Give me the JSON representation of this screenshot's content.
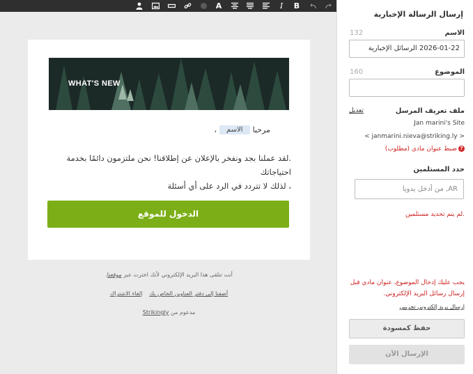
{
  "toolbar": {
    "icons": [
      "person-icon",
      "image-icon",
      "divider-icon",
      "link-icon",
      "color-dot-icon",
      "font-icon",
      "align-center-icon",
      "align-justify-icon",
      "align-left-icon",
      "italic-icon",
      "bold-icon",
      "undo-icon",
      "redo-icon"
    ],
    "font_glyph": "A",
    "italic_glyph": "I",
    "bold_glyph": "B"
  },
  "email": {
    "banner_text": "WHAT'S NEW",
    "greeting": "مرحبا",
    "name_placeholder": "الاسم",
    "greeting_comma": "،",
    "paragraph_line1": ".لقد عملنا بجد ونفخر بالإعلان عن إطلاقنا! نحن ملتزمون دائمًا بخدمة احتياجاتك",
    "paragraph_line2": "، لذلك لا تتردد في الرد على أي أسئلة",
    "button_label": "الدخول للموقع"
  },
  "footer": {
    "line1_text": "أنت تتلقى هذا البريد الإلكتروني لأنك اخترت عبر",
    "line1_link": "موقعنا",
    "line1_end": ".",
    "addbook_link": "أضفنا إلى دفتر العناوين الخاص بك",
    "unsubscribe_link": "إلغاء الاشتراك",
    "powered_text": "مدعوم من",
    "powered_link": "Strikingly"
  },
  "sidebar": {
    "title": "إرسال الرسالة الإخبارية",
    "name_label": "الاسم",
    "name_count": "132",
    "name_value": "2026-01-22 الرسائل الإخبارية",
    "subject_label": "الموضوع",
    "subject_count": "160",
    "subject_value": "",
    "sender_label": "ملف تعريف المرسل",
    "edit_link": "تعديل",
    "sender_name": "Jan marini's Site",
    "sender_email": "< janmarini.nieva@striking.ly >",
    "sender_error": "ضبط عنوان مادي (مطلوب)",
    "recipients_label": "حدد المستلمين",
    "recipients_placeholder": "AR, من أدخل يدويا",
    "no_recipients": ".لم يتم تحديد مستلمين",
    "warning_line1": "يجب عليك إدخال الموضوع، عنوان مادي قبل",
    "warning_line2": "إرسال رسائل البريد الإلكتروني.",
    "test_link": "إرسال بريد إلكتروني تجريبي",
    "draft_button": "حفظ كمسودة",
    "send_button": "الإرسال الآن"
  },
  "colors": {
    "toolbar_bg": "#2f2f2f",
    "primary_button": "#7caf17",
    "error": "#cc1f1f"
  }
}
